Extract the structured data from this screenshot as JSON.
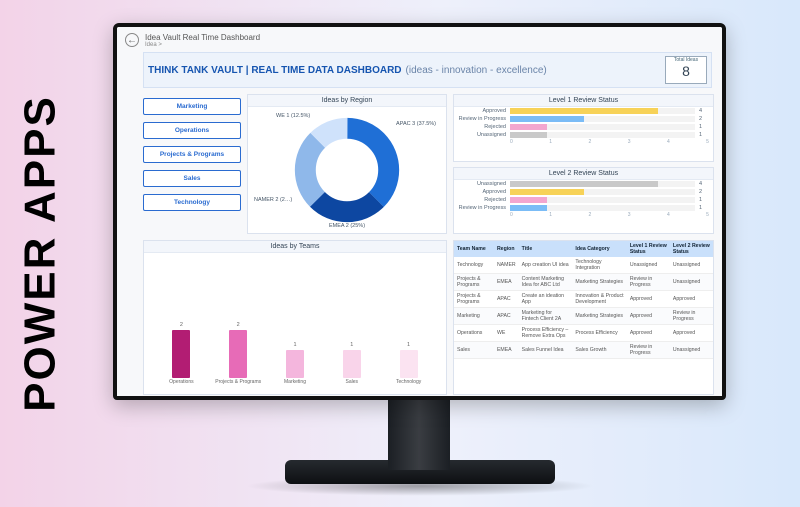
{
  "side_label": "POWER APPS",
  "window": {
    "title": "Idea Vault Real Time Dashboard",
    "sub": "Idea >"
  },
  "banner": {
    "title": "THINK TANK VAULT  | REAL TIME DATA DASHBOARD",
    "sub": "(ideas - innovation - excellence)",
    "total_label": "Total Ideas",
    "total_value": "8"
  },
  "filters": [
    "Marketing",
    "Operations",
    "Projects & Programs",
    "Sales",
    "Technology"
  ],
  "region_panel": {
    "title": "Ideas by Region",
    "labels": {
      "we": "WE  1 (12.5%)",
      "apac": "APAC\n3 (37.5%)",
      "namer": "NAMER\n2 (2…)",
      "emea": "EMEA 2 (25%)"
    }
  },
  "review1": {
    "title": "Level 1 Review Status",
    "rows": [
      {
        "label": "Approved",
        "value": 4,
        "color": "#f7d258"
      },
      {
        "label": "Review in Progress",
        "value": 2,
        "color": "#7bbcf6"
      },
      {
        "label": "Rejected",
        "value": 1,
        "color": "#f3a6cf"
      },
      {
        "label": "Unassigned",
        "value": 1,
        "color": "#c9c9c9"
      }
    ],
    "axis": [
      "0",
      "1",
      "2",
      "3",
      "4",
      "5"
    ]
  },
  "review2": {
    "title": "Level 2 Review Status",
    "rows": [
      {
        "label": "Unassigned",
        "value": 4,
        "color": "#c9c9c9"
      },
      {
        "label": "Approved",
        "value": 2,
        "color": "#f7d258"
      },
      {
        "label": "Rejected",
        "value": 1,
        "color": "#f3a6cf"
      },
      {
        "label": "Review in Progress",
        "value": 1,
        "color": "#7bbcf6"
      }
    ],
    "axis": [
      "0",
      "1",
      "2",
      "3",
      "4",
      "5"
    ]
  },
  "teams": {
    "title": "Ideas by Teams",
    "max": 3,
    "items": [
      {
        "cat": "Operations",
        "value": 2,
        "color": "#b21d73"
      },
      {
        "cat": "Projects & Programs",
        "value": 2,
        "color": "#e76bb7"
      },
      {
        "cat": "Marketing",
        "value": 1,
        "color": "#f4b6dd"
      },
      {
        "cat": "Sales",
        "value": 1,
        "color": "#f9d4ea"
      },
      {
        "cat": "Technology",
        "value": 1,
        "color": "#fbe3f1"
      }
    ]
  },
  "table": {
    "headers": [
      "Team Name",
      "Region",
      "Title",
      "Idea Category",
      "Level 1 Review Status",
      "Level 2 Review Status"
    ],
    "rows": [
      [
        "Technology",
        "NAMER",
        "App creation UI idea",
        "Technology Integration",
        "Unassigned",
        "Unassigned"
      ],
      [
        "Projects & Programs",
        "EMEA",
        "Content Marketing Idea for ABC Ltd",
        "Marketing Strategies",
        "Review in Progress",
        "Unassigned"
      ],
      [
        "Projects & Programs",
        "APAC",
        "Create an ideation App",
        "Innovation & Product Development",
        "Approved",
        "Approved"
      ],
      [
        "Marketing",
        "APAC",
        "Marketing for Fintech Client 2A",
        "Marketing Strategies",
        "Approved",
        "Review in Progress"
      ],
      [
        "Operations",
        "WE",
        "Process Efficiency – Remove Extra Ops",
        "Process Efficiency",
        "Approved",
        "Approved"
      ],
      [
        "Sales",
        "EMEA",
        "Sales Funnel Idea",
        "Sales Growth",
        "Review in Progress",
        "Unassigned"
      ]
    ]
  },
  "chart_data": [
    {
      "type": "pie",
      "title": "Ideas by Region",
      "series": [
        {
          "name": "APAC",
          "value": 3,
          "pct": 37.5,
          "color": "#1f6fd6"
        },
        {
          "name": "EMEA",
          "value": 2,
          "pct": 25.0,
          "color": "#0d47a1"
        },
        {
          "name": "NAMER",
          "value": 2,
          "pct": 25.0,
          "color": "#8fb8ea"
        },
        {
          "name": "WE",
          "value": 1,
          "pct": 12.5,
          "color": "#cfe2fb"
        }
      ]
    },
    {
      "type": "bar",
      "title": "Level 1 Review Status",
      "categories": [
        "Approved",
        "Review in Progress",
        "Rejected",
        "Unassigned"
      ],
      "values": [
        4,
        2,
        1,
        1
      ],
      "xlabel": "",
      "ylabel": "",
      "ylim": [
        0,
        5
      ]
    },
    {
      "type": "bar",
      "title": "Level 2 Review Status",
      "categories": [
        "Unassigned",
        "Approved",
        "Rejected",
        "Review in Progress"
      ],
      "values": [
        4,
        2,
        1,
        1
      ],
      "xlabel": "",
      "ylabel": "",
      "ylim": [
        0,
        5
      ]
    },
    {
      "type": "bar",
      "title": "Ideas by Teams",
      "categories": [
        "Operations",
        "Projects & Programs",
        "Marketing",
        "Sales",
        "Technology"
      ],
      "values": [
        2,
        2,
        1,
        1,
        1
      ],
      "xlabel": "",
      "ylabel": "",
      "ylim": [
        0,
        3
      ]
    }
  ]
}
